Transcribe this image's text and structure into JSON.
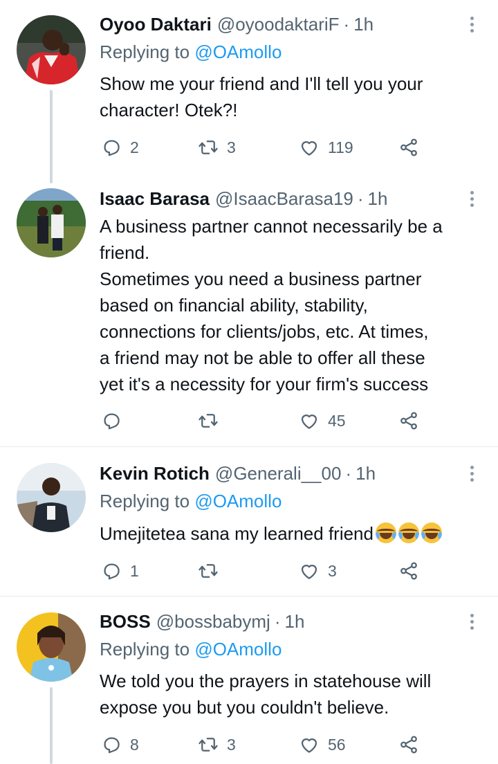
{
  "replying_to_prefix": "Replying to ",
  "tweets": [
    {
      "name": "Oyoo Daktari",
      "handle": "@oyoodaktariF",
      "dot": "·",
      "time": "1h",
      "replying_to": "@OAmollo",
      "text": [
        "Show me your friend and I'll tell you your",
        "character! Otek?!"
      ],
      "replies": "2",
      "retweets": "3",
      "likes": "119"
    },
    {
      "name": "Isaac Barasa",
      "handle": "@IsaacBarasa19",
      "dot": "·",
      "time": "1h",
      "text": [
        "A business partner cannot necessarily be a",
        "friend.",
        "Sometimes you need a business partner",
        "based on financial ability, stability,",
        "connections for clients/jobs, etc. At times,",
        "a friend may not be able to offer all these",
        "yet it's a necessity for your firm's success"
      ],
      "replies": "",
      "retweets": "",
      "likes": "45"
    },
    {
      "name": "Kevin Rotich",
      "handle": "@Generali__00",
      "dot": "·",
      "time": "1h",
      "replying_to": "@OAmollo",
      "text": [
        "Umejitetea sana my learned friend"
      ],
      "emoji": [
        "face-with-tears-of-joy",
        "face-with-tears-of-joy",
        "face-with-tears-of-joy"
      ],
      "replies": "1",
      "retweets": "",
      "likes": "3"
    },
    {
      "name": "BOSS",
      "handle": "@bossbabymj",
      "dot": "·",
      "time": "1h",
      "replying_to": "@OAmollo",
      "text": [
        "We told you the prayers in statehouse will",
        "expose you but you couldn't believe."
      ],
      "replies": "8",
      "retweets": "3",
      "likes": "56"
    }
  ],
  "colors": {
    "text": "#0f1419",
    "secondary": "#536471",
    "link": "#1d9bf0",
    "divider": "#e6ecf0",
    "thread": "#cfd9de"
  }
}
